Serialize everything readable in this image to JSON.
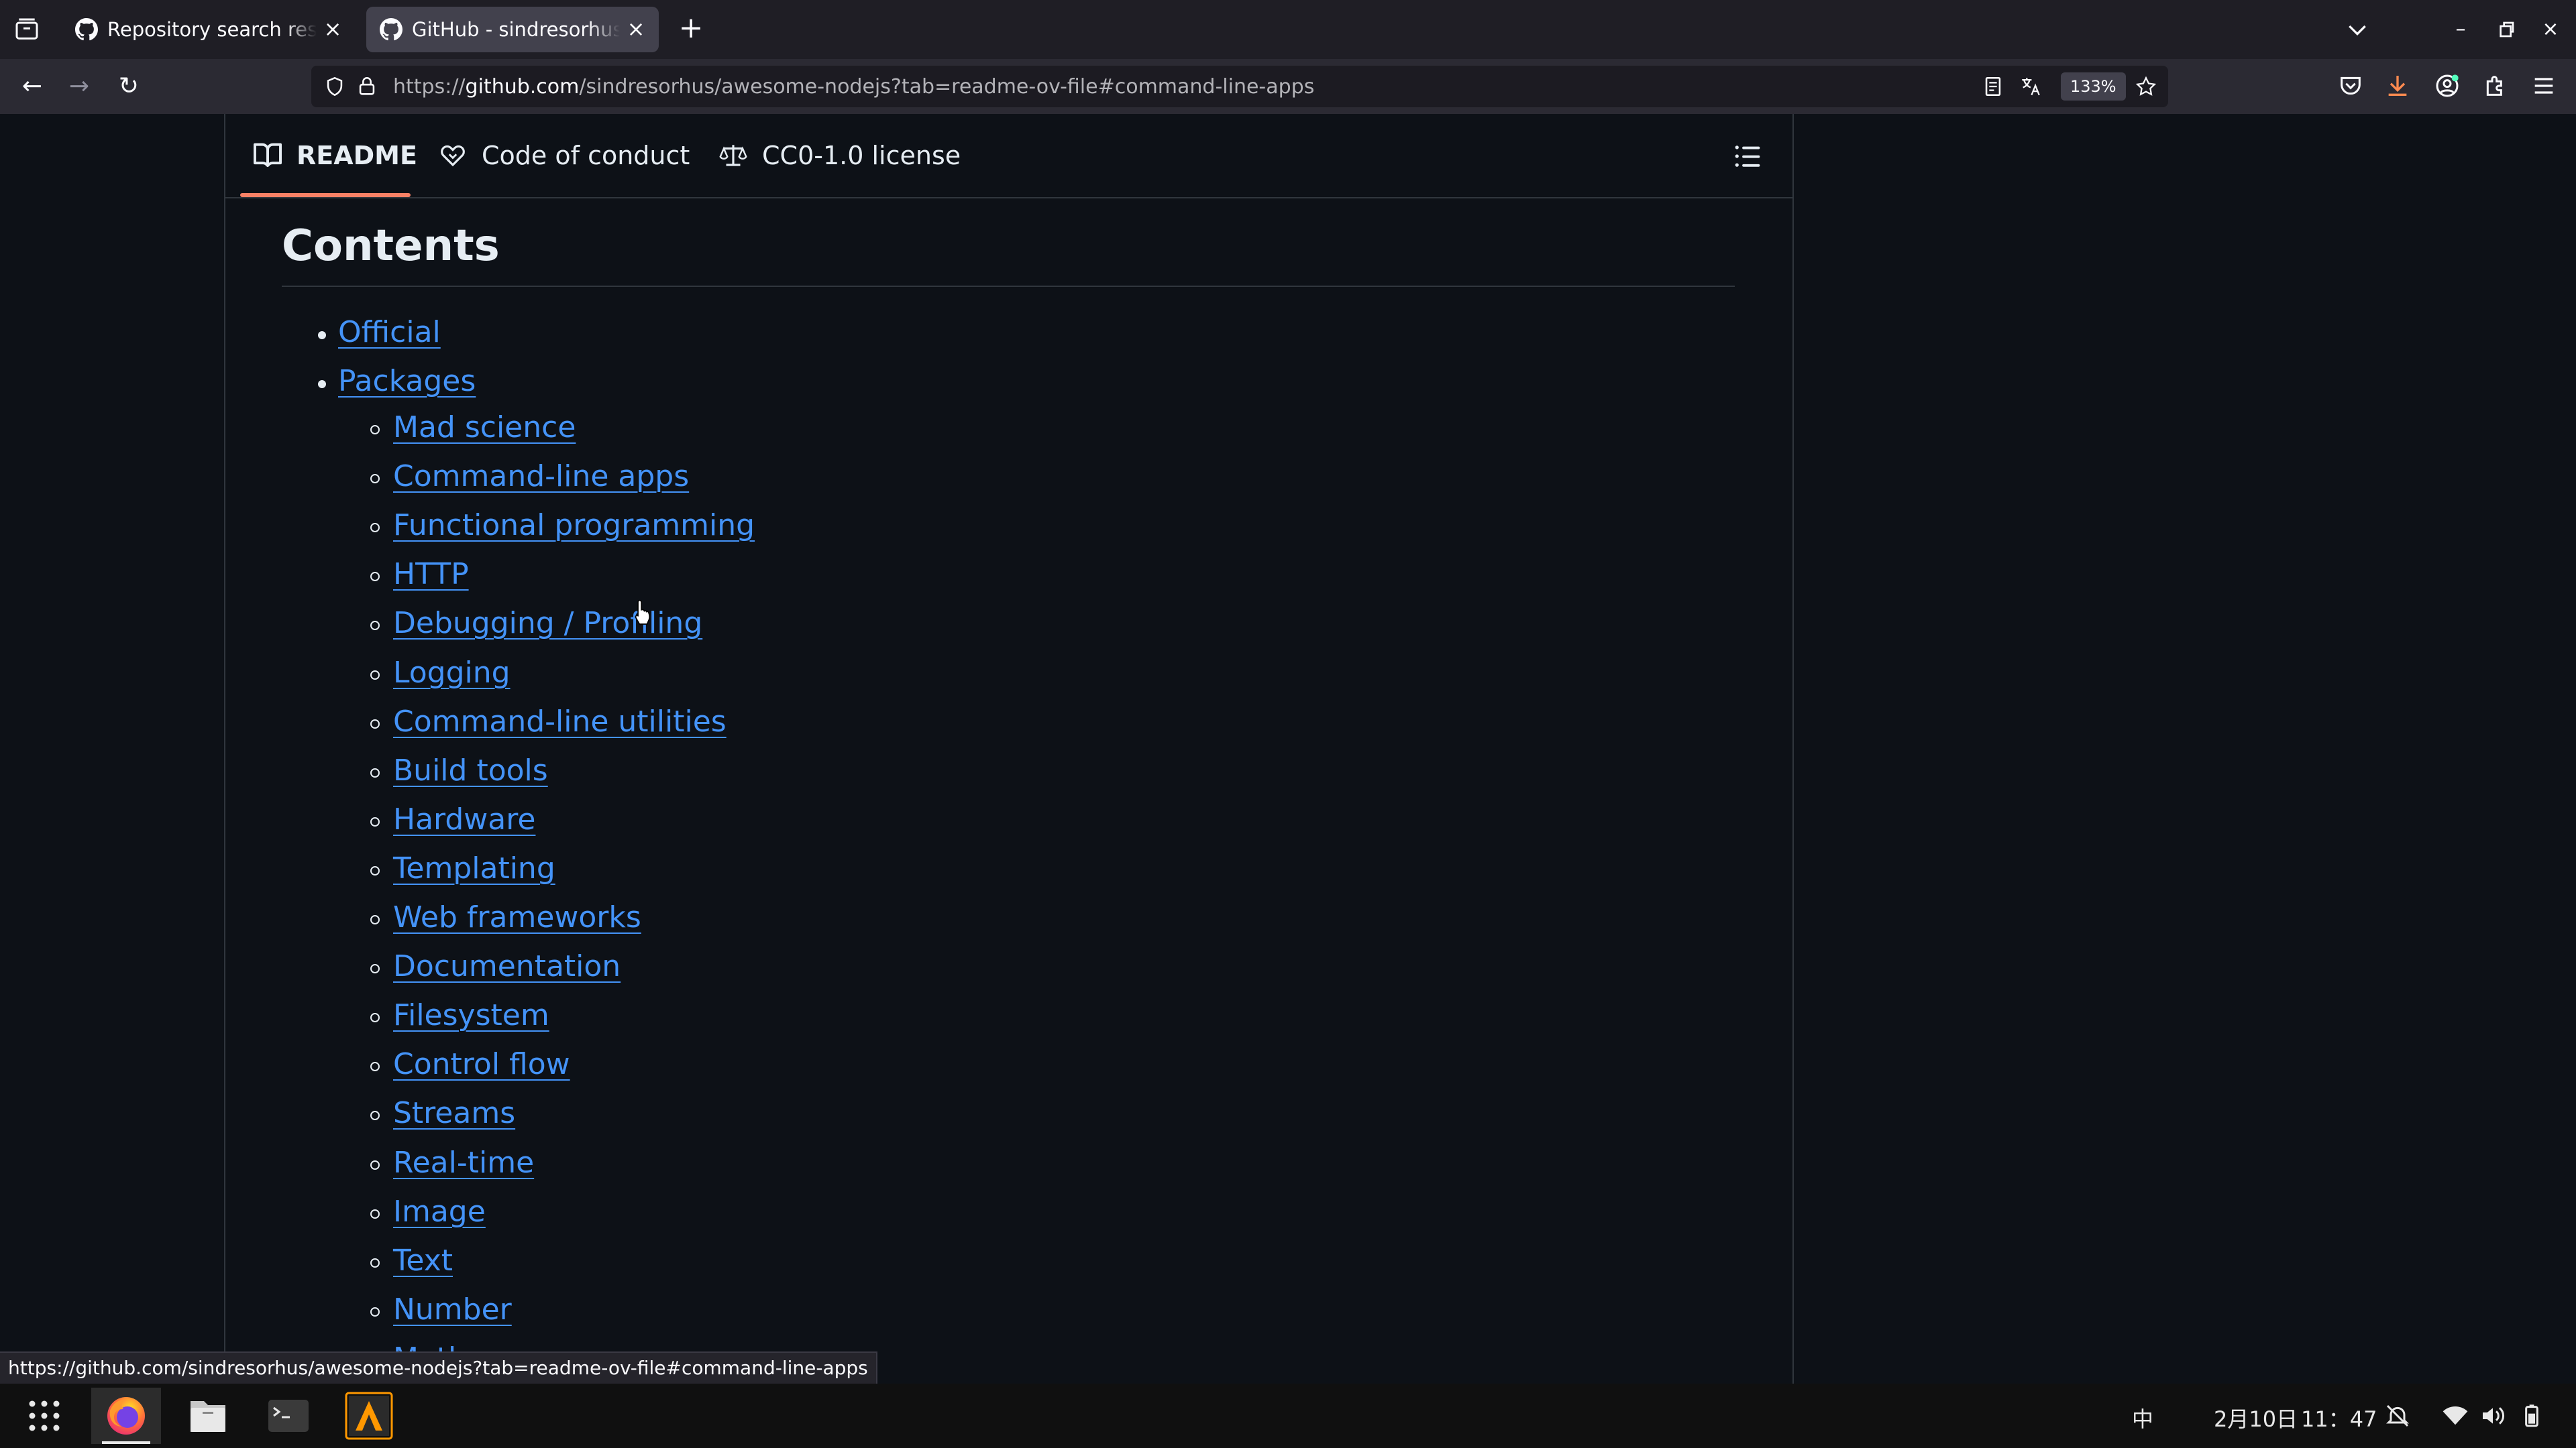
{
  "browser": {
    "tabs": [
      {
        "title": "Repository search results",
        "active": false
      },
      {
        "title": "GitHub - sindresorhus/awesome-nodejs",
        "active": true
      }
    ],
    "url": {
      "prefix": "https://",
      "host": "github.com",
      "path": "/sindresorhus/awesome-nodejs?tab=readme-ov-file#command-line-apps"
    },
    "zoom": "133%",
    "status_url": "https://github.com/sindresorhus/awesome-nodejs?tab=readme-ov-file#command-line-apps"
  },
  "readme_tabs": [
    {
      "label": "README",
      "icon": "book-icon",
      "selected": true
    },
    {
      "label": "Code of conduct",
      "icon": "heart-handshake-icon",
      "selected": false
    },
    {
      "label": "CC0-1.0 license",
      "icon": "law-scale-icon",
      "selected": false
    }
  ],
  "contents": {
    "heading": "Contents",
    "top_items": [
      "Official",
      "Packages"
    ],
    "sub_items": [
      "Mad science",
      "Command-line apps",
      "Functional programming",
      "HTTP",
      "Debugging / Profiling",
      "Logging",
      "Command-line utilities",
      "Build tools",
      "Hardware",
      "Templating",
      "Web frameworks",
      "Documentation",
      "Filesystem",
      "Control flow",
      "Streams",
      "Real-time",
      "Image",
      "Text",
      "Number",
      "Math"
    ]
  },
  "taskbar": {
    "apps": [
      "app-grid",
      "firefox",
      "files",
      "terminal",
      "sublime-text"
    ],
    "input_method": "中",
    "date": "2月10日",
    "time": "11：47"
  },
  "colors": {
    "link": "#4493f8",
    "page_bg": "#0d1117",
    "tab_underline": "#f78166"
  }
}
